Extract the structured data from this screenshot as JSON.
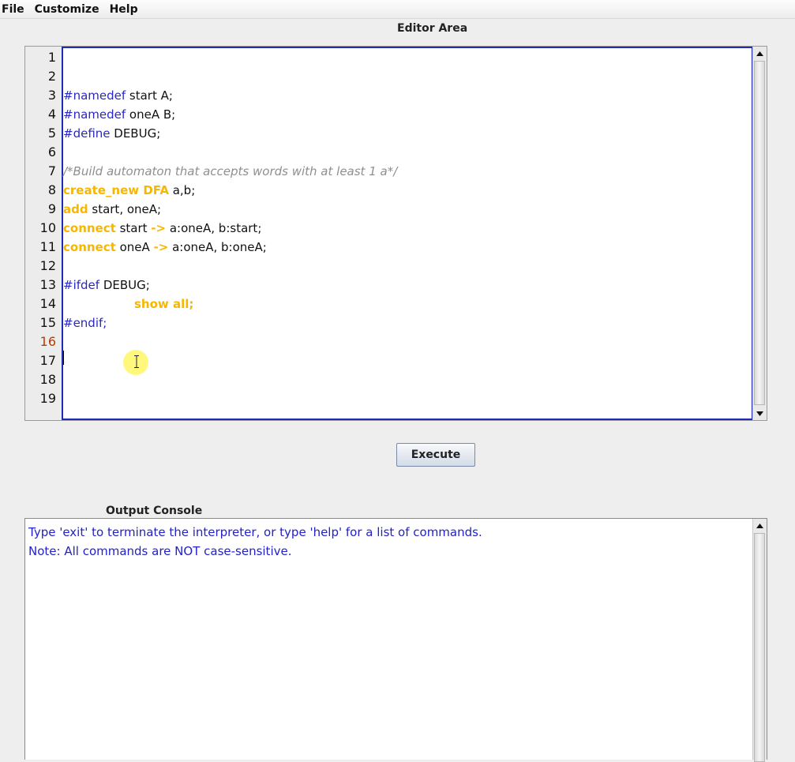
{
  "menu": {
    "file": "File",
    "customize": "Customize",
    "help": "Help"
  },
  "editor": {
    "title": "Editor Area",
    "current_line": 16,
    "line_numbers": [
      "1",
      "2",
      "3",
      "4",
      "5",
      "6",
      "7",
      "8",
      "9",
      "10",
      "11",
      "12",
      "13",
      "14",
      "15",
      "16",
      "17",
      "18",
      "19"
    ],
    "code": {
      "l3_dir": "#namedef",
      "l3_rest": " start A;",
      "l4_dir": "#namedef",
      "l4_rest": " oneA B;",
      "l5_dir": "#define",
      "l5_rest": " DEBUG;",
      "l7_comment": "/*Build automaton that accepts words with at least 1 a*/",
      "l8_kw": "create_new DFA",
      "l8_rest": " a,b;",
      "l9_kw": "add",
      "l9_rest": " start, oneA;",
      "l10_kw": "connect",
      "l10_mid": " start ",
      "l10_arrow": "->",
      "l10_rest": " a:oneA, b:start;",
      "l11_kw": "connect",
      "l11_mid": " oneA ",
      "l11_arrow": "->",
      "l11_rest": " a:oneA, b:oneA;",
      "l13_dir": "#ifdef",
      "l13_rest": " DEBUG;",
      "l14_kw": "show all;",
      "l15_dir": "#endif;"
    }
  },
  "execute_button": "Execute",
  "console": {
    "title": "Output Console",
    "lines": [
      "Type 'exit' to terminate the interpreter, or type 'help' for a list of commands.",
      "Note: All commands are NOT case-sensitive."
    ]
  },
  "colors": {
    "directive": "#2a28c2",
    "keyword": "#f5b700",
    "comment": "#8f8f8f",
    "console_text": "#2222c8",
    "editor_border": "#1f2bb8",
    "current_line_number": "#b83a00"
  }
}
